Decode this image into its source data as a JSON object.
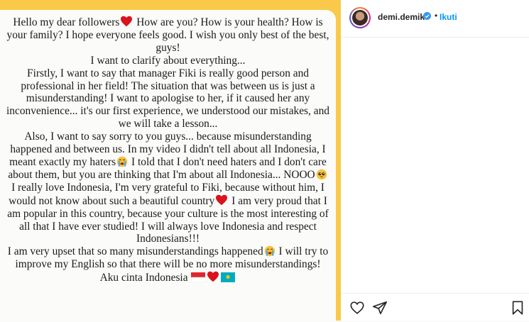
{
  "post": {
    "story_lines": [
      "Hello my dear followers",
      "How are you? How is your health? How is your family? I hope everyone feels good. I wish you only best of the best, guys!",
      "I want to clarify about everything...",
      "Firstly, I want to say that manager Fiki is really good person and professional in her field! The situation that was between us is just a misunderstanding! I want to apologise to her, if it caused her any inconvenience... it's our first experience, we understood our mistakes, and we will take a lesson...",
      "Also, I want to say sorry to you guys... because misunderstanding happened and between us. In my video I didn't tell about all Indonesia, I meant exactly my haters",
      "I told that I don't need haters and I don't care about them, but you are thinking that I'm about all Indonesia... NOOO",
      "I really love Indonesia, I'm very grateful to Fiki, because without him, I would not know about such a beautiful country",
      "I am very proud that I am popular in this country, because your culture is the most interesting of all that I have ever studied! I will always love Indonesia and respect Indonesians!!!",
      "I am very upset that so many misunderstandings happened",
      "I will try to improve my English so that there will be no more misunderstandings!",
      "Aku cinta Indonesia"
    ],
    "emojis": {
      "heart": "red-heart-emoji",
      "crying": "loudly-crying-emoji",
      "pleading": "pleading-face-emoji",
      "flag_id": "indonesia-flag-emoji",
      "flag_kz": "kazakhstan-flag-emoji"
    },
    "background_color": "#fbc94a"
  },
  "header": {
    "username": "demi.demik",
    "separator": "•",
    "follow_label": "Ikuti"
  },
  "colors": {
    "accent": "#0095f6",
    "verified": "#3897f0",
    "text": "#262626"
  },
  "actions": {
    "icons": [
      "heart-outline-icon",
      "share-icon",
      "save-bookmark-icon"
    ]
  }
}
